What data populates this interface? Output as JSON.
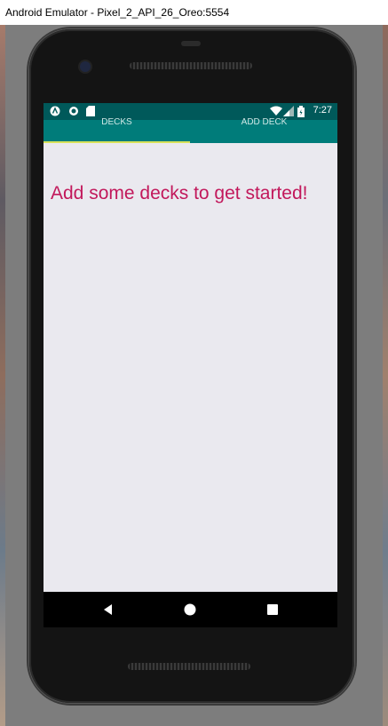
{
  "window": {
    "title": "Android Emulator - Pixel_2_API_26_Oreo:5554"
  },
  "status_bar": {
    "time": "7:27",
    "left_icons": [
      "android-notification-icon",
      "circle-notification-icon",
      "sd-card-icon"
    ],
    "right_icons": [
      "wifi-icon",
      "signal-icon",
      "battery-icon"
    ]
  },
  "tabs": [
    {
      "label": "DECKS",
      "selected": true
    },
    {
      "label": "ADD DECK",
      "selected": false
    }
  ],
  "main": {
    "empty_message": "Add some decks to get started!"
  },
  "colors": {
    "status_bar": "#00595a",
    "tab_bar": "#007c7a",
    "tab_indicator": "#d9e25a",
    "message_text": "#c2185b",
    "screen_bg": "#eae9ef"
  },
  "nav_bar": {
    "buttons": [
      "back-icon",
      "home-icon",
      "recents-icon"
    ]
  }
}
